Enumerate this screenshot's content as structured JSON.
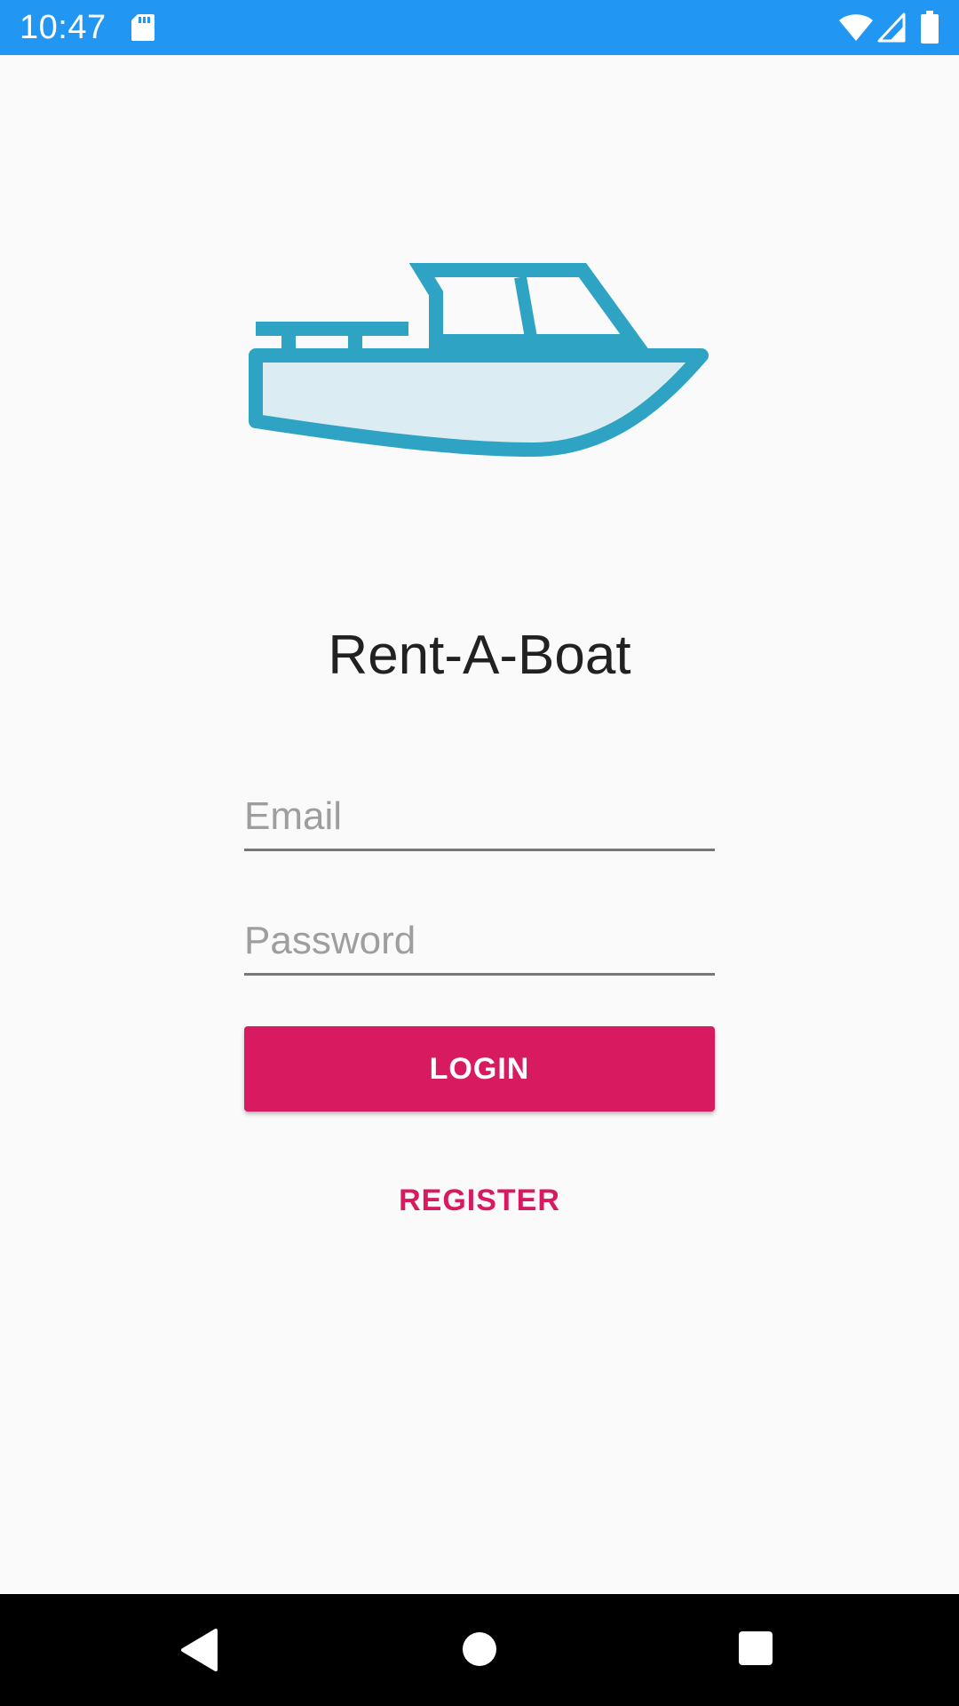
{
  "status_bar": {
    "time": "10:47",
    "icons": [
      "sd-card-icon",
      "wifi-icon",
      "cellular-signal-icon",
      "battery-icon"
    ],
    "background_color": "#2196f3"
  },
  "logo": {
    "icon": "boat-icon",
    "stroke_color": "#2fa3c3",
    "fill_color": "#dbedf2"
  },
  "app": {
    "title": "Rent-A-Boat"
  },
  "form": {
    "email_placeholder": "Email",
    "email_value": "",
    "password_placeholder": "Password",
    "password_value": ""
  },
  "actions": {
    "login_label": "LOGIN",
    "register_label": "REGISTER",
    "accent_color": "#d81b60"
  },
  "navigation": {
    "buttons": [
      "back-icon",
      "home-icon",
      "recents-icon"
    ]
  }
}
